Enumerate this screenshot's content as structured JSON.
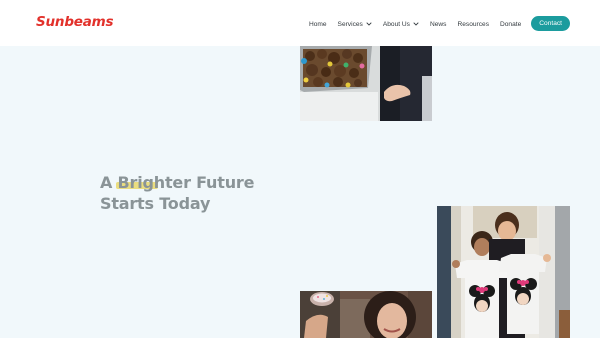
{
  "brand": {
    "logo_text": "Sunbeams",
    "color": "#e2312b"
  },
  "nav": {
    "items": [
      {
        "label": "Home",
        "has_dropdown": false
      },
      {
        "label": "Services",
        "has_dropdown": true
      },
      {
        "label": "About Us",
        "has_dropdown": true
      },
      {
        "label": "News",
        "has_dropdown": false
      },
      {
        "label": "Resources",
        "has_dropdown": false
      },
      {
        "label": "Donate",
        "has_dropdown": false
      }
    ],
    "contact_label": "Contact",
    "contact_color": "#1c9c9e"
  },
  "hero": {
    "line1": "A Brighter Future",
    "line2": "Starts Today",
    "highlight_color": "#e9d86a"
  },
  "images": {
    "food": "tray of chocolate cornflake treats in colourful cases",
    "girls": "two girls holding t-shirts with Minnie Mouse prints",
    "woman": "smiling woman decorating a cake"
  }
}
